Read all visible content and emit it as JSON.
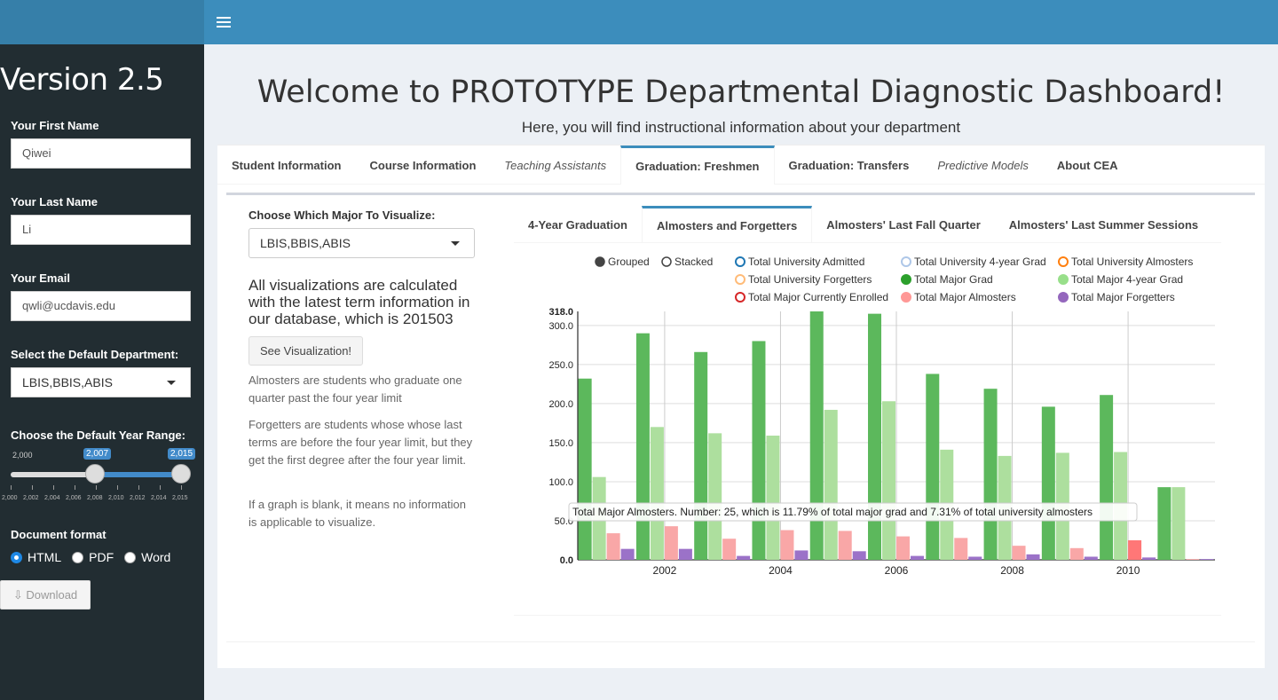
{
  "app": {
    "version": "Version 2.5"
  },
  "sidebar": {
    "first_name_label": "Your First Name",
    "first_name_value": "Qiwei",
    "last_name_label": "Your Last Name",
    "last_name_value": "Li",
    "email_label": "Your Email",
    "email_value": "qwli@ucdavis.edu",
    "department_label": "Select the Default Department:",
    "department_value": "LBIS,BBIS,ABIS",
    "year_range_label": "Choose the Default Year Range:",
    "year_min_label": "2,000",
    "year_max_label": "2,015",
    "year_from": "2,007",
    "year_to": "2,015",
    "year_ticks": [
      "2,000",
      "2,002",
      "2,004",
      "2,006",
      "2,008",
      "2,010",
      "2,012",
      "2,014",
      "2,015"
    ],
    "doc_format_label": "Document format",
    "formats": [
      "HTML",
      "PDF",
      "Word"
    ],
    "selected_format": "HTML",
    "download_label": "Download"
  },
  "main": {
    "title": "Welcome to PROTOTYPE Departmental Diagnostic Dashboard!",
    "subtitle": "Here, you will find instructional information about your department",
    "tabs": [
      {
        "label": "Student Information",
        "italic": false
      },
      {
        "label": "Course Information",
        "italic": false
      },
      {
        "label": "Teaching Assistants",
        "italic": true
      },
      {
        "label": "Graduation: Freshmen",
        "italic": false,
        "active": true
      },
      {
        "label": "Graduation: Transfers",
        "italic": false
      },
      {
        "label": "Predictive Models",
        "italic": true
      },
      {
        "label": "About CEA",
        "italic": false
      }
    ],
    "major_label": "Choose Which Major To Visualize:",
    "major_value": "LBIS,BBIS,ABIS",
    "info_text": "All visualizations are calculated with the latest term information in our database, which is 201503",
    "see_button": "See Visualization!",
    "note1": "Almosters are students who graduate one quarter past the four year limit",
    "note2": "Forgetters are students whose whose last terms are before the four year limit, but they get the first degree after the four year limit.",
    "note3": "If a graph is blank, it means no information is applicable to visualize.",
    "subtabs": [
      {
        "label": "4-Year Graduation"
      },
      {
        "label": "Almosters and Forgetters",
        "active": true
      },
      {
        "label": "Almosters' Last Fall Quarter"
      },
      {
        "label": "Almosters' Last Summer Sessions"
      }
    ]
  },
  "colors": {
    "header": "#3c8dbc",
    "logo_bar": "#367fa9",
    "sidebar": "#222d32",
    "major_grad": "#5cb85c",
    "major_4yr": "#addf9e",
    "major_almosters": "#f9a7a7",
    "major_forgetters": "#9b72c8"
  },
  "chart_data": {
    "type": "bar",
    "mode_options": [
      "Grouped",
      "Stacked"
    ],
    "selected_mode": "Grouped",
    "legend": [
      {
        "name": "Total University Admitted",
        "color": "#1f77b4",
        "visible": false
      },
      {
        "name": "Total University 4-year Grad",
        "color": "#aec7e8",
        "visible": false
      },
      {
        "name": "Total University Almosters",
        "color": "#ff7f0e",
        "visible": false
      },
      {
        "name": "Total University Forgetters",
        "color": "#ffbb78",
        "visible": false
      },
      {
        "name": "Total Major Grad",
        "color": "#2ca02c",
        "visible": true
      },
      {
        "name": "Total Major 4-year Grad",
        "color": "#98df8a",
        "visible": true
      },
      {
        "name": "Total Major Currently Enrolled",
        "color": "#d62728",
        "visible": false
      },
      {
        "name": "Total Major Almosters",
        "color": "#ff9896",
        "visible": true
      },
      {
        "name": "Total Major Forgetters",
        "color": "#9467bd",
        "visible": true
      }
    ],
    "x": [
      2001,
      2002,
      2003,
      2004,
      2005,
      2006,
      2007,
      2008,
      2009,
      2010,
      2011
    ],
    "x_ticks": [
      2002,
      2004,
      2006,
      2008,
      2010
    ],
    "ylim": [
      0,
      318
    ],
    "y_ticks": [
      "0.0",
      "50.0",
      "100.0",
      "150.0",
      "200.0",
      "250.0",
      "300.0",
      "318.0"
    ],
    "series": [
      {
        "name": "Total Major Grad",
        "values": [
          232,
          290,
          266,
          280,
          318,
          315,
          238,
          219,
          196,
          211,
          93
        ]
      },
      {
        "name": "Total Major 4-year Grad",
        "values": [
          106,
          170,
          162,
          159,
          192,
          203,
          141,
          133,
          137,
          138,
          93
        ]
      },
      {
        "name": "Total Major Almosters",
        "values": [
          34,
          43,
          27,
          38,
          37,
          30,
          28,
          18,
          15,
          25,
          1
        ]
      },
      {
        "name": "Total Major Forgetters",
        "values": [
          14,
          14,
          5,
          12,
          11,
          5,
          4,
          7,
          4,
          3,
          1
        ]
      }
    ],
    "tooltip": "Total Major Almosters. Number: 25, which is 11.79% of total major grad and 7.31% of total university almosters"
  }
}
